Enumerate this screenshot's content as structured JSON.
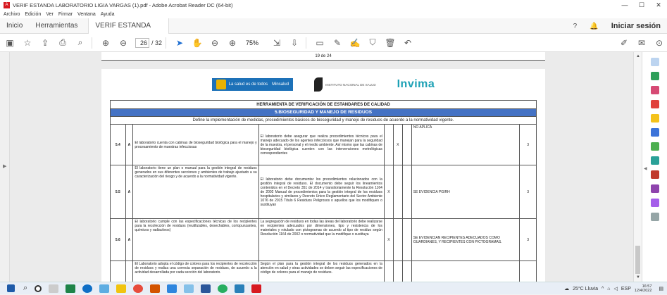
{
  "window": {
    "title": "VERIF ESTANDA LABORATORIO LIGIA VARGAS (1).pdf - Adobe Acrobat Reader DC (64-bit)",
    "min": "—",
    "max": "☐",
    "close": "✕"
  },
  "menu": [
    "Archivo",
    "Edición",
    "Ver",
    "Firmar",
    "Ventana",
    "Ayuda"
  ],
  "tabs": {
    "home": "Inicio",
    "tools": "Herramientas",
    "doc": "VERIF ESTANDA LA...",
    "doc_close": "×",
    "help": "?",
    "bell": "🔔",
    "login": "Iniciar sesión"
  },
  "toolbar": {
    "page_current": "26",
    "page_total": "/ 32",
    "zoom": "75%"
  },
  "page": {
    "header_text": "19 de 24",
    "logos": {
      "salud_text": "La salud es de todos",
      "salud_sub": "Minsalud",
      "ins_text": "INSTITUTO NACIONAL DE SALUD",
      "invima_text": "Invima"
    },
    "table_title": "HERRAMIENTA DE VERIFICACIÓN DE ESTANDARES DE CALIDAD",
    "section_title": "5.BIOSEGURIDAD Y MANEJO DE RESIDUOS",
    "section_desc": "Define la implementación de medidas, procedimientos básicos de bioseguridad y manejo de residuos de acuerdo a la normatividad vigente.",
    "rows": [
      {
        "num": "5.4",
        "cat": "A",
        "desc": "El laboratorio cuenta con cabinas de bioseguridad biológica para el manejo y procesamiento de muestras infecciosas",
        "verif": "El laboratorio debe asegurar que realiza procedimientos técnicos para el manejo adecuado de los agentes infecciosos que manejan para la seguridad de la muestra, el personal y el medio ambiente. Así mismo que las cabinas de bioseguridad biológica cuenten con las intervenciones metrológicas correspondientes",
        "mark": "X",
        "obs": "NO APLICA",
        "val": "3"
      },
      {
        "num": "5.5",
        "cat": "A",
        "desc": "El laboratorio tiene un plan o manual para la gestión integral de residuos generados en sus diferentes secciones y ambientes de trabajo ajustado a su caracterización del riesgo y de acuerdo a la normatividad vigente.",
        "verif": "El laboratorio debe documentar los procedimientos relacionados con la gestión integral de residuos. El documento debe seguir los lineamientos contenidos en el Decreto 351 de 2014 y transitoriamente la Resolución 1164 de 2002 Manual de procedimientos para la gestión integral de los residuos hospitalarios y similares y Decreto Único Reglamentario del Sector Ambiente 1076 de 2015 Título 6 Residuos Peligrosos o aquellos que los modifiquen o sustituyan",
        "mark": "X",
        "obs": "SE EVIDENCIA PGIRH",
        "val": "3"
      },
      {
        "num": "5.6",
        "cat": "A",
        "desc": "El laboratorio cumple con las especificaciones técnicas de los recipientes para la recolección de residuos (reutilizables, desechables, cortopunzantes, químicos y radiactivos)",
        "verif": "La segregación de residuos en todas las áreas del laboratorio debe realizarse en recipientes adecuados por dimensiones, tipo y resistencia de los materiales y rotulado con pictogramas de acuerdo al tipo de residuo según Resolución 1164 de 2002 o normatividad que la modifique o sustituya",
        "mark": "X",
        "obs": "SE EVIDENCIAN RECIPIENTES ADECUADOS COMO GUARDIANES, Y RECIPIENTES CON PICTOGRAMAS.",
        "val": "3"
      },
      {
        "num": "",
        "cat": "",
        "desc": "El Laboratorio adopta el código de colores para los recipientes de recolección de residuos y realiza una correcta separación de residuos, de acuerdo a la actividad desarrollada por cada sección del laboratorio.",
        "verif": "Según el plan para la gestión integral de los residuos generados en la atención en salud y otras actividades se deben seguir las especificaciones de código de colores para el manejo de residuos.",
        "mark": "",
        "obs": "",
        "val": ""
      }
    ]
  },
  "taskbar": {
    "weather": "25°C Lluvia",
    "lang": "ESP",
    "time": "16:57",
    "date": "12/4/2022"
  }
}
